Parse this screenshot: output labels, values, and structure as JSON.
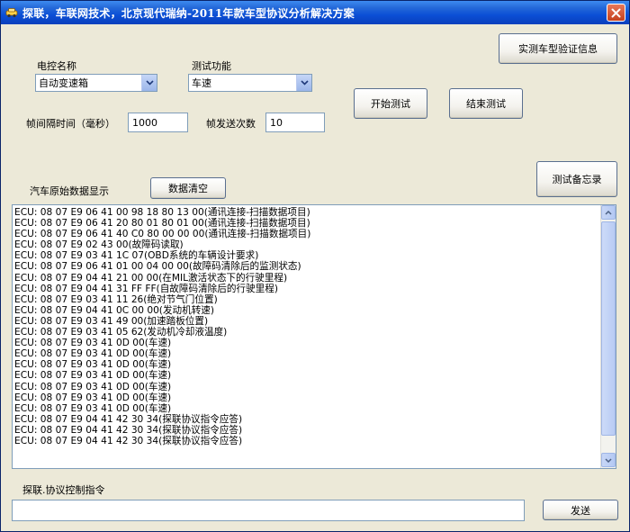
{
  "window": {
    "title": "探联，车联网技术，北京现代瑞纳-2011年款车型协议分析解决方案"
  },
  "ecu": {
    "label": "电控名称",
    "selected": "自动变速箱"
  },
  "test_function": {
    "label": "测试功能",
    "selected": "车速"
  },
  "frame_interval": {
    "label": "帧间隔时间（毫秒）",
    "value": "1000"
  },
  "frame_count": {
    "label": "帧发送次数",
    "value": "10"
  },
  "buttons": {
    "verify": "实测车型验证信息",
    "start": "开始测试",
    "stop": "结束测试",
    "memo": "测试备忘录",
    "clear": "数据清空",
    "send": "发送"
  },
  "raw_data_label": "汽车原始数据显示",
  "log": [
    "ECU: 08 07 E9 06 41 00 98 18 80 13 00(通讯连接-扫描数据项目)",
    "ECU: 08 07 E9 06 41 20 80 01 80 01 00(通讯连接-扫描数据项目)",
    "ECU: 08 07 E9 06 41 40 C0 80 00 00 00(通讯连接-扫描数据项目)",
    "ECU: 08 07 E9 02 43 00(故障码读取)",
    "ECU: 08 07 E9 03 41 1C 07(OBD系统的车辆设计要求)",
    "ECU: 08 07 E9 06 41 01 00 04 00 00(故障码清除后的监测状态)",
    "ECU: 08 07 E9 04 41 21 00 00(在MIL激活状态下的行驶里程)",
    "ECU: 08 07 E9 04 41 31 FF FF(自故障码清除后的行驶里程)",
    "ECU: 08 07 E9 03 41 11 26(绝对节气门位置)",
    "ECU: 08 07 E9 04 41 0C 00 00(发动机转速)",
    "ECU: 08 07 E9 03 41 49 00(加速踏板位置)",
    "ECU: 08 07 E9 03 41 05 62(发动机冷却液温度)",
    "ECU: 08 07 E9 03 41 0D 00(车速)",
    "ECU: 08 07 E9 03 41 0D 00(车速)",
    "ECU: 08 07 E9 03 41 0D 00(车速)",
    "ECU: 08 07 E9 03 41 0D 00(车速)",
    "ECU: 08 07 E9 03 41 0D 00(车速)",
    "ECU: 08 07 E9 03 41 0D 00(车速)",
    "ECU: 08 07 E9 03 41 0D 00(车速)",
    "ECU: 08 07 E9 04 41 42 30 34(探联协议指令应答)",
    "ECU: 08 07 E9 04 41 42 30 34(探联协议指令应答)",
    "ECU: 08 07 E9 04 41 42 30 34(探联协议指令应答)"
  ],
  "command": {
    "label": "探联.协议控制指令",
    "value": ""
  },
  "icons": {
    "title": "car-icon",
    "close": "close-icon",
    "dropdown": "chevron-down-icon",
    "scroll_up": "arrow-up-icon",
    "scroll_down": "arrow-down-icon"
  },
  "colors": {
    "titlebar": "#0b4fd6",
    "background": "#ece9d8",
    "close": "#c4401c"
  }
}
